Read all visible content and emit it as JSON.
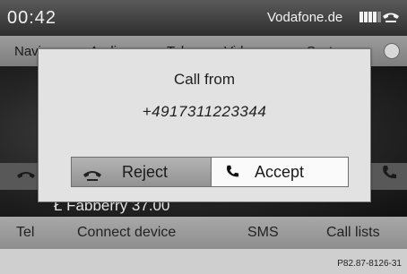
{
  "status": {
    "clock": "00:42",
    "carrier": "Vodafone.de",
    "signal_bars": 4,
    "signal_max": 5
  },
  "menu": {
    "items": [
      {
        "label": "Navi"
      },
      {
        "label": "Audio"
      },
      {
        "label": "Tel"
      },
      {
        "label": "Video"
      },
      {
        "label": "System"
      }
    ]
  },
  "background": {
    "entry_text": "Ł Fabberry 37.00"
  },
  "dialog": {
    "title": "Call from",
    "number": "+4917311223344",
    "reject_label": "Reject",
    "accept_label": "Accept"
  },
  "bottom_bar": {
    "items": [
      {
        "label": "Tel"
      },
      {
        "label": "Connect device"
      },
      {
        "label": "SMS"
      },
      {
        "label": "Call lists"
      }
    ]
  },
  "footer_code": "P82.87-8126-31",
  "colors": {
    "dialog_bg": "#e2e2e2",
    "accept_selected": "#fafafa",
    "status_bg": "#3a3a3a"
  }
}
